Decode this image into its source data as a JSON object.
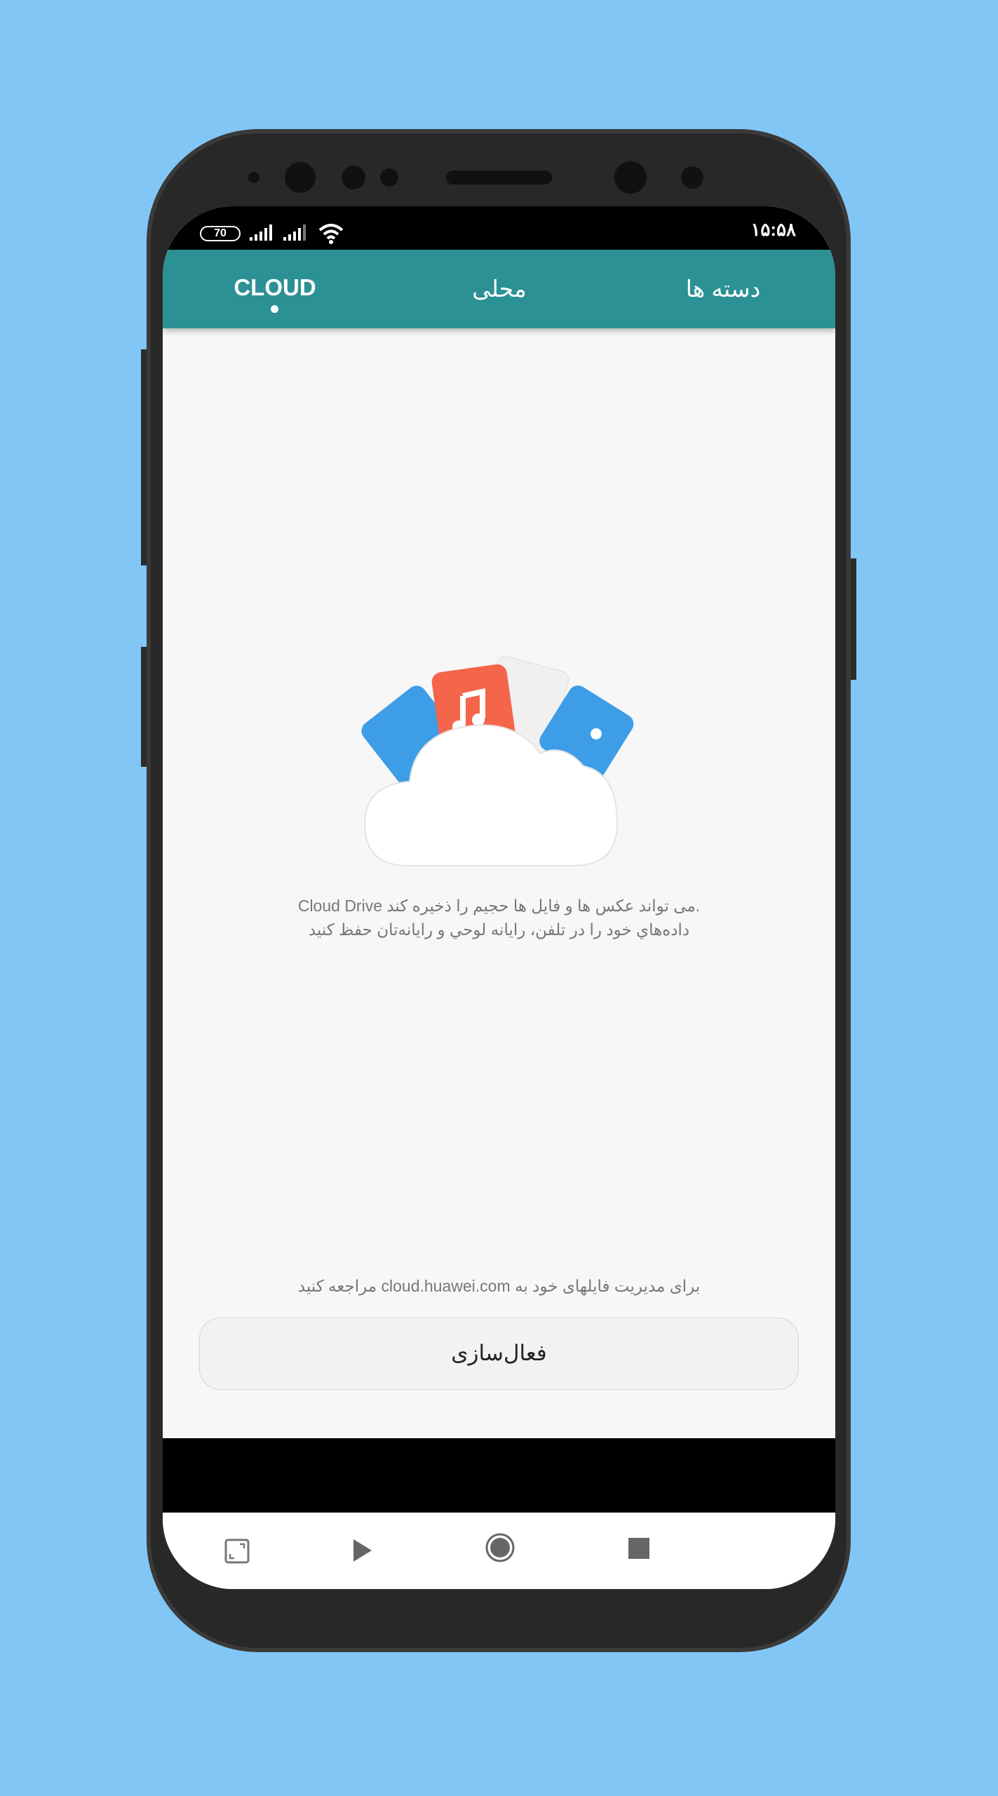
{
  "status_bar": {
    "battery": "70",
    "time": "۱۵:۵۸",
    "icons": [
      "battery-icon",
      "signal-icon",
      "signal-icon",
      "wifi-icon"
    ]
  },
  "tabs": [
    {
      "label": "CLOUD",
      "active": true
    },
    {
      "label": "محلی",
      "active": false
    },
    {
      "label": "دسته ها",
      "active": false
    }
  ],
  "colors": {
    "accent": "#2c9194",
    "background": "#82c6f6"
  },
  "main": {
    "description_line1": ".می تواند عکس ها و فایل ها حجیم را ذخیره کند Cloud Drive",
    "description_line2": "داده‌هاي خود را در تلفن، رايانه لوحي و رايانه‌تان حفظ کنيد",
    "manage_hint": "برای مدیریت فایلهای خود به cloud.huawei.com مراجعه کنید",
    "activate_label": "فعال‌سازی"
  },
  "nav_bar": {
    "icons": [
      "screenshot-icon",
      "play-icon",
      "home-icon",
      "stop-icon"
    ]
  }
}
